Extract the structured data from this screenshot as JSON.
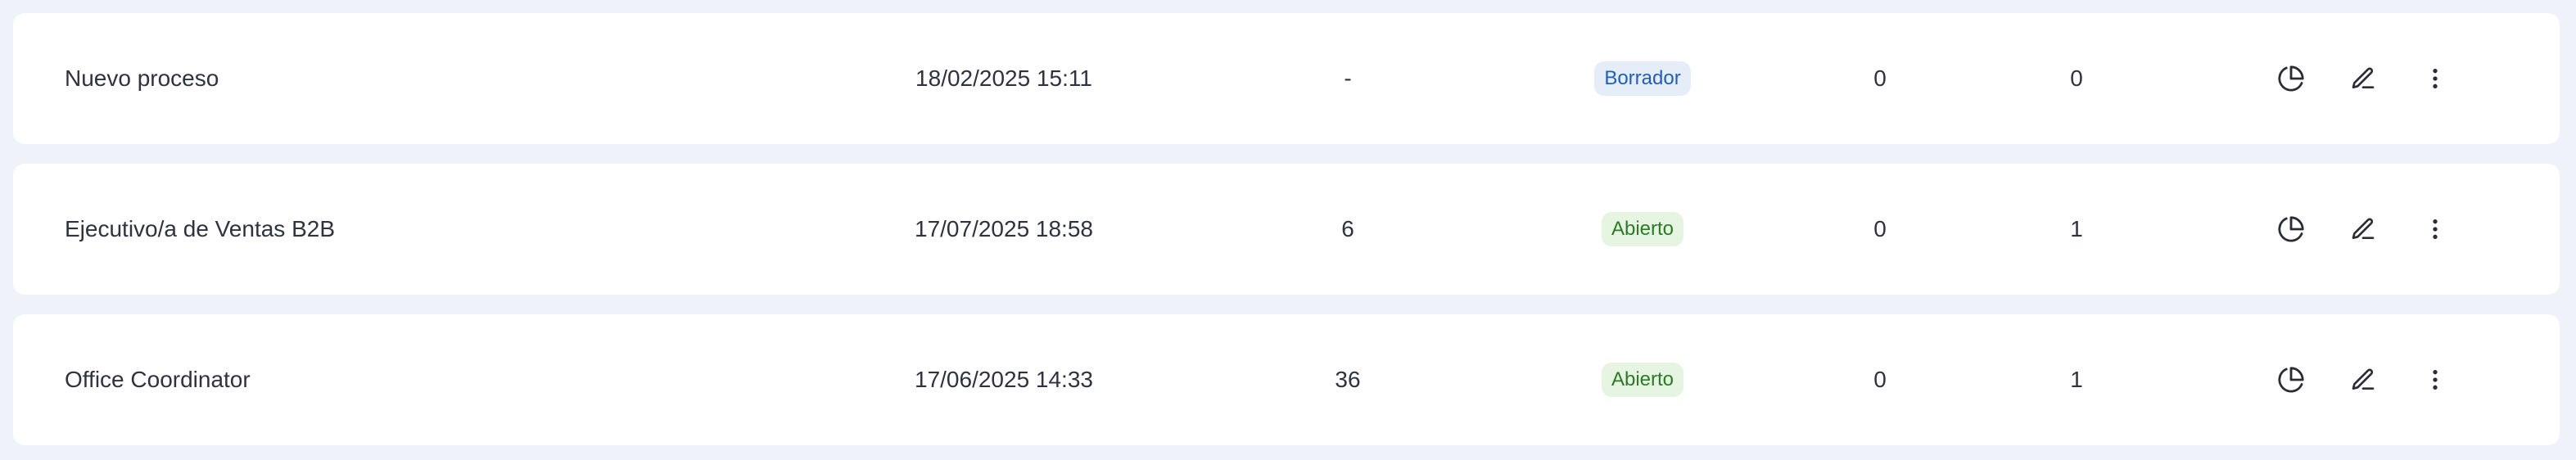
{
  "rows": [
    {
      "name": "Nuevo proceso",
      "date": "18/02/2025 15:11",
      "count": "-",
      "status": "Borrador",
      "status_kind": "draft",
      "col_a": "0",
      "col_b": "0"
    },
    {
      "name": "Ejecutivo/a de Ventas B2B",
      "date": "17/07/2025 18:58",
      "count": "6",
      "status": "Abierto",
      "status_kind": "open",
      "col_a": "0",
      "col_b": "1"
    },
    {
      "name": "Office Coordinator",
      "date": "17/06/2025 14:33",
      "count": "36",
      "status": "Abierto",
      "status_kind": "open",
      "col_a": "0",
      "col_b": "1"
    }
  ],
  "icons": {
    "stats": "pie-chart-icon",
    "edit": "pencil-icon",
    "more": "more-vertical-icon"
  },
  "colors": {
    "page_background": "#eff2f8",
    "row_background": "#ffffff",
    "draft_badge_bg": "#e5edf9",
    "draft_badge_text": "#1f5fb8",
    "open_badge_bg": "#e6f5e2",
    "open_badge_text": "#2c7a28"
  }
}
